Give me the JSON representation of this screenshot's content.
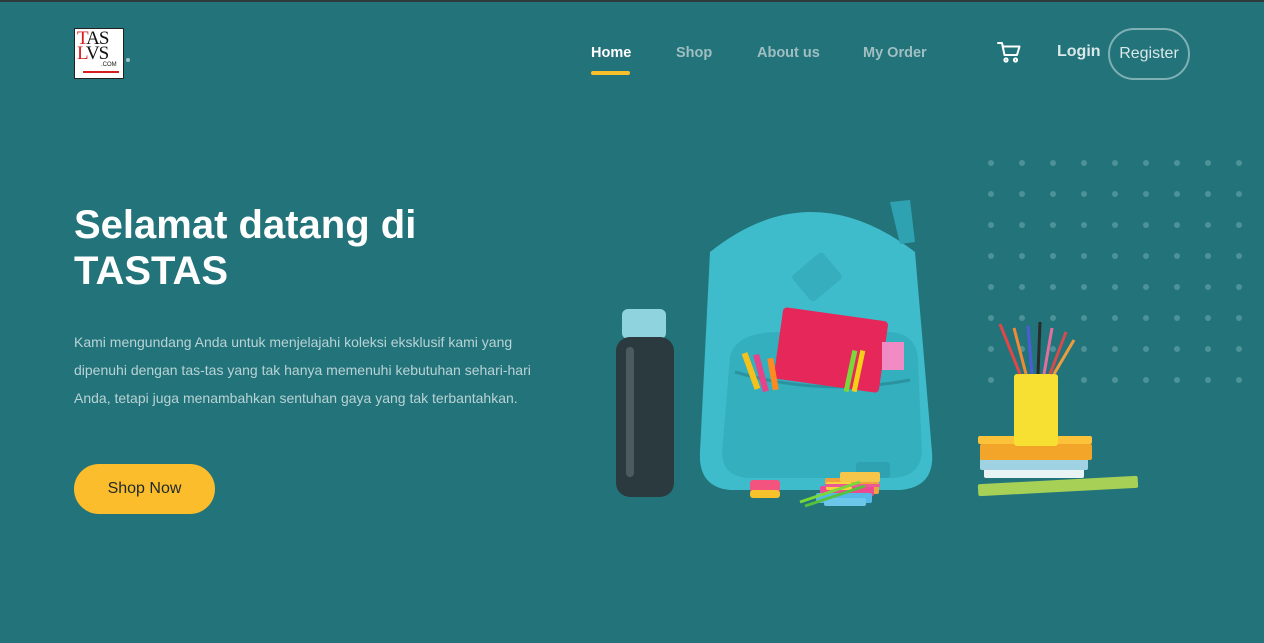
{
  "header": {
    "logo": {
      "line1": "TAS",
      "line2": "LVS",
      "line3": ".COM"
    },
    "nav": [
      {
        "label": "Home",
        "active": true
      },
      {
        "label": "Shop",
        "active": false
      },
      {
        "label": "About us",
        "active": false
      },
      {
        "label": "My Order",
        "active": false
      }
    ],
    "cart_icon": "cart-icon",
    "login_label": "Login",
    "register_label": "Register"
  },
  "hero": {
    "title": "Selamat datang di TASTAS",
    "description": "Kami mengundang Anda untuk menjelajahi koleksi eksklusif kami yang dipenuhi dengan tas-tas yang tak hanya memenuhi kebutuhan sehari-hari Anda, tetapi juga menambahkan sentuhan gaya yang tak terbantahkan.",
    "cta_label": "Shop Now"
  },
  "colors": {
    "background": "#23737a",
    "accent": "#fbbd2b",
    "text_muted": "#b8d3d5"
  }
}
